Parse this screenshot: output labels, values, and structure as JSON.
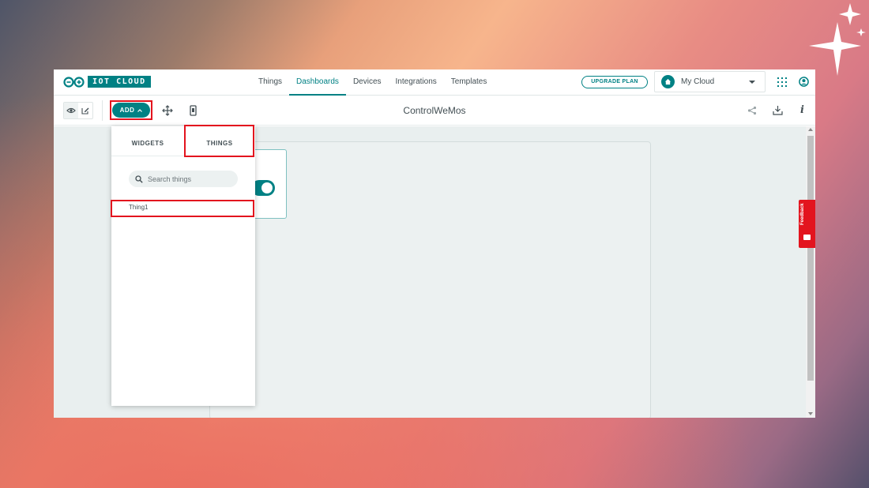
{
  "app": {
    "logo_text": "IOT CLOUD",
    "nav": [
      "Things",
      "Dashboards",
      "Devices",
      "Integrations",
      "Templates"
    ],
    "active_nav": "Dashboards",
    "upgrade_label": "UPGRADE PLAN",
    "space_selector": "My Cloud",
    "accent_color": "#008184",
    "highlight_color": "#e3141e"
  },
  "toolbar": {
    "add_label": "ADD",
    "dashboard_title": "ControlWeMos"
  },
  "add_panel": {
    "tabs": [
      "WIDGETS",
      "THINGS"
    ],
    "active_tab": "THINGS",
    "search_placeholder": "Search things",
    "items": [
      "Thing1"
    ]
  },
  "feedback_label": "Feedback",
  "icons": [
    "arduino-logo-icon",
    "home-icon",
    "apps-grid-icon",
    "user-icon",
    "eye-icon",
    "edit-icon",
    "chevron-up-icon",
    "move-icon",
    "phone-icon",
    "share-icon",
    "download-icon",
    "info-icon",
    "search-icon",
    "sparkle-icon"
  ]
}
